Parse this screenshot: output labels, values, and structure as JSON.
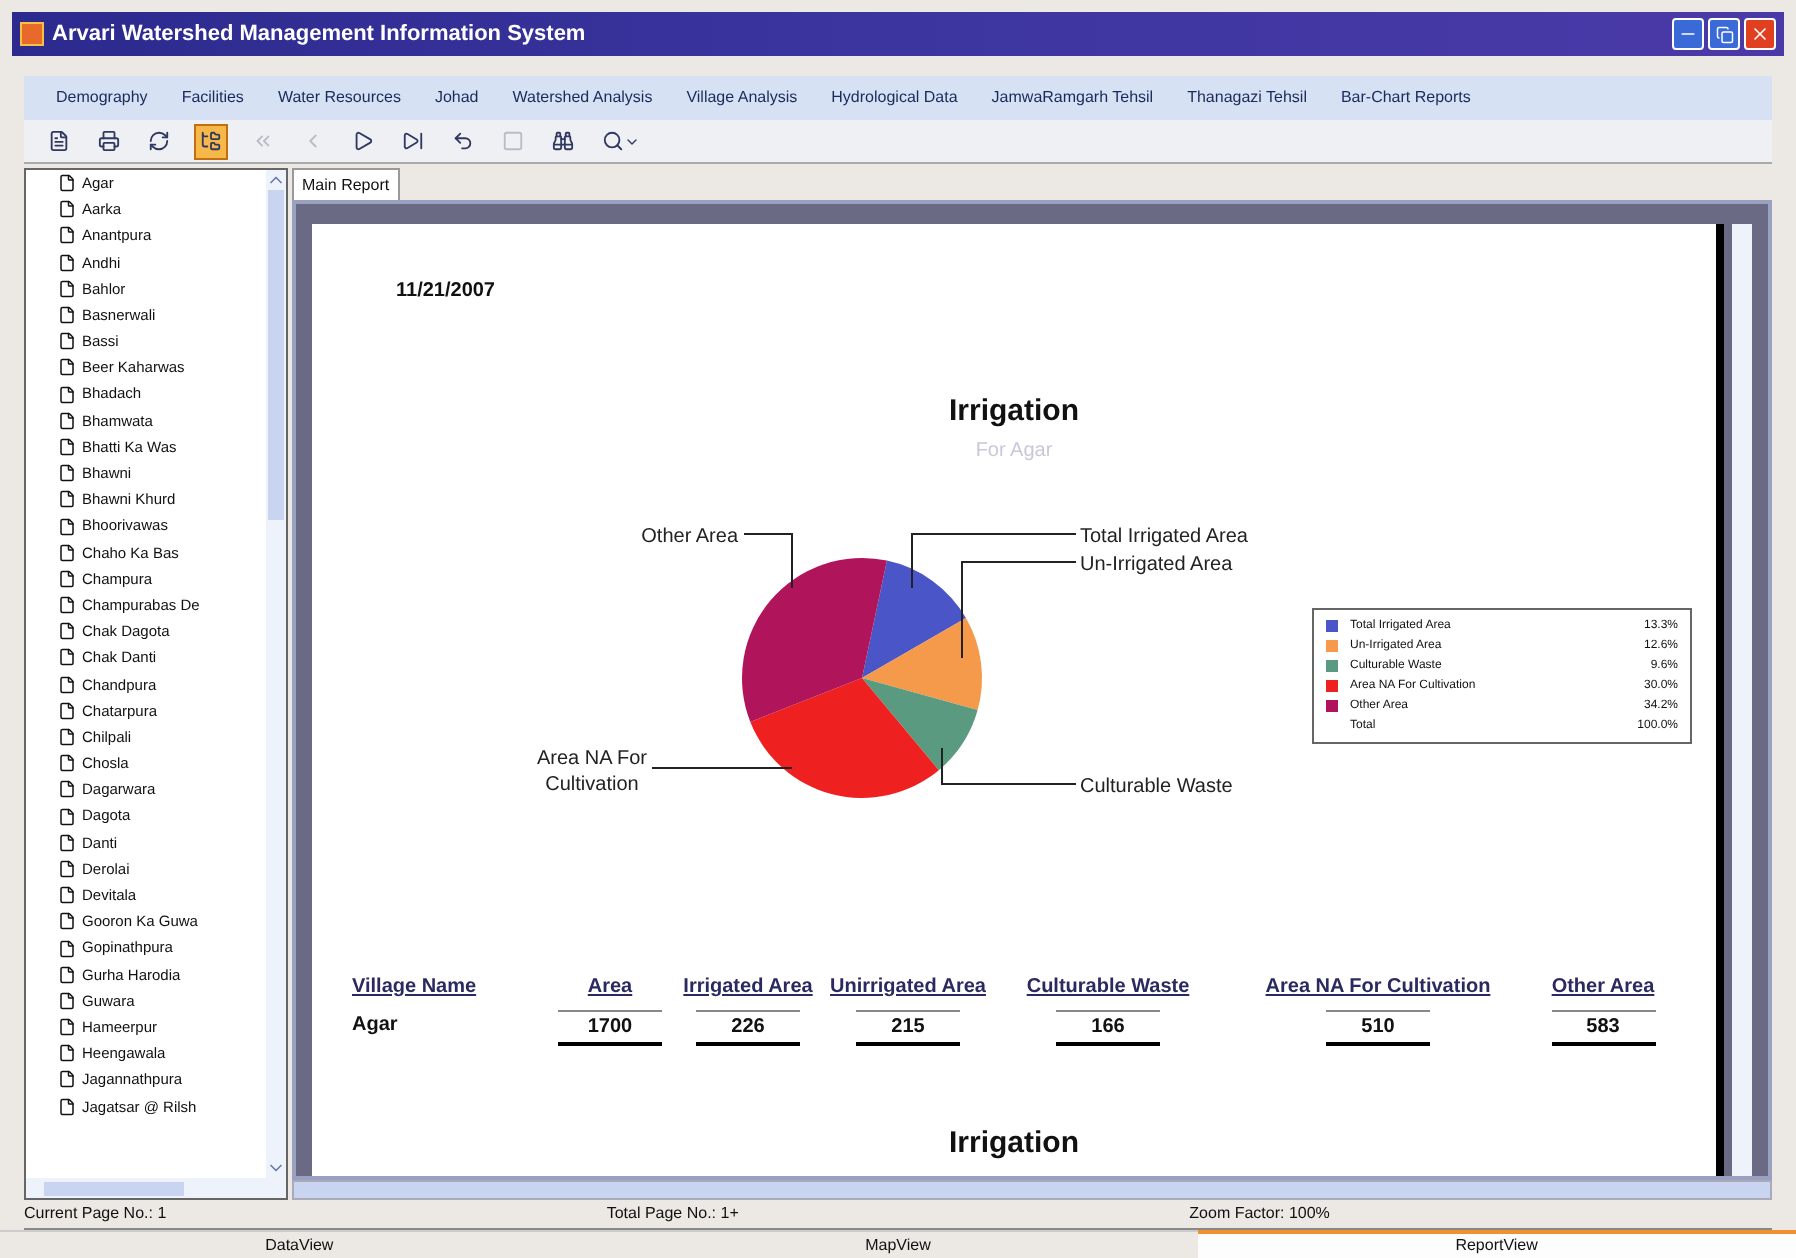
{
  "window": {
    "title": "Arvari Watershed Management Information System"
  },
  "menu": [
    "Demography",
    "Facilities",
    "Water Resources",
    "Johad",
    "Watershed Analysis",
    "Village Analysis",
    "Hydrological Data",
    "JamwaRamgarh Tehsil",
    "Thanagazi Tehsil",
    "Bar-Chart Reports"
  ],
  "toolbar": [
    {
      "kind": "page-setup",
      "disabled": false,
      "selected": false
    },
    {
      "kind": "print",
      "disabled": false,
      "selected": false
    },
    {
      "kind": "refresh",
      "disabled": false,
      "selected": false
    },
    {
      "kind": "tree",
      "disabled": false,
      "selected": true
    },
    {
      "kind": "first",
      "disabled": true,
      "selected": false
    },
    {
      "kind": "prev",
      "disabled": true,
      "selected": false
    },
    {
      "kind": "next",
      "disabled": false,
      "selected": false
    },
    {
      "kind": "last",
      "disabled": false,
      "selected": false
    },
    {
      "kind": "back",
      "disabled": false,
      "selected": false
    },
    {
      "kind": "stop",
      "disabled": true,
      "selected": false
    },
    {
      "kind": "find",
      "disabled": false,
      "selected": false
    },
    {
      "kind": "zoom",
      "disabled": false,
      "selected": false
    }
  ],
  "sidebar": {
    "items": [
      "Agar",
      "Aarka",
      "Anantpura",
      "Andhi",
      "Bahlor",
      "Basnerwali",
      "Bassi",
      "Beer Kaharwas",
      "Bhadach",
      "Bhamwata",
      "Bhatti Ka Was",
      "Bhawni",
      "Bhawni Khurd",
      "Bhoorivawas",
      "Chaho Ka Bas",
      "Champura",
      "Champurabas De",
      "Chak Dagota",
      "Chak Danti",
      "Chandpura",
      "Chatarpura",
      "Chilpali",
      "Chosla",
      "Dagarwara",
      "Dagota",
      "Danti",
      "Derolai",
      "Devitala",
      "Gooron Ka Guwa",
      "Gopinathpura",
      "Gurha Harodia",
      "Guwara",
      "Hameerpur",
      "Heengawala",
      "Jagannathpura",
      "Jagatsar @ Rilsh"
    ]
  },
  "report": {
    "tab": "Main Report",
    "date": "11/21/2007",
    "subtitle": "For Agar",
    "chart_data": {
      "type": "pie",
      "title": "Irrigation",
      "categories": [
        "Total Irrigated Area",
        "Un-Irrigated Area",
        "Culturable Waste",
        "Area NA For Cultivation",
        "Other Area"
      ],
      "values": [
        13.3,
        12.6,
        9.6,
        30.0,
        34.2
      ],
      "colors": [
        "#4a55c8",
        "#f49a4a",
        "#5a9a80",
        "#ee2020",
        "#b0145a"
      ]
    },
    "legend": [
      {
        "label": "Total Irrigated Area",
        "value": "13.3%"
      },
      {
        "label": "Un-Irrigated Area",
        "value": "12.6%"
      },
      {
        "label": "Culturable Waste",
        "value": "9.6%"
      },
      {
        "label": "Area NA For Cultivation",
        "value": "30.0%"
      },
      {
        "label": "Other Area",
        "value": "34.2%"
      }
    ],
    "legend_total": {
      "label": "Total",
      "value": "100.0%"
    },
    "table": {
      "columns": [
        "Village Name",
        "Area",
        "Irrigated Area",
        "Unirrigated Area",
        "Culturable Waste",
        "Area NA For Cultivation",
        "Other Area"
      ],
      "rows": [
        [
          "Agar",
          "1700",
          "226",
          "215",
          "166",
          "510",
          "583"
        ]
      ]
    },
    "next_title": "Irrigation"
  },
  "status_bar": [
    "Current Page No.: 1",
    "Total Page No.: 1+",
    "Zoom Factor: 100%"
  ],
  "bottom_tabs": [
    {
      "label": "DataView",
      "selected": false
    },
    {
      "label": "MapView",
      "selected": false
    },
    {
      "label": "ReportView",
      "selected": true
    }
  ]
}
